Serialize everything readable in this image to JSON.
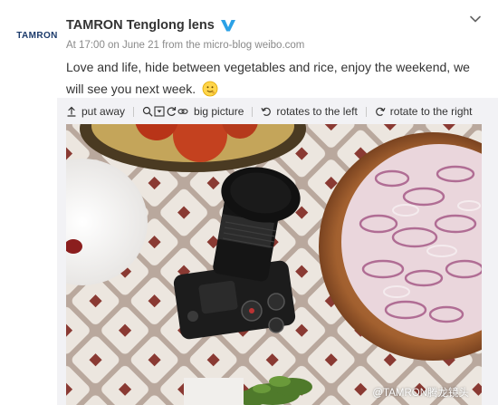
{
  "post": {
    "avatar_text": "TAMRON",
    "author": "TAMRON Tenglong lens",
    "verified_icon": "verified-v-icon",
    "meta": "At 17:00 on June 21 from the micro-blog weibo.com",
    "text": "Love and life, hide between vegetables and rice, enjoy the weekend, we will see you next week.",
    "emoji_icon": "smile-emoji-icon"
  },
  "toolbar": {
    "put_away": "put away",
    "big_picture": "big picture",
    "rotate_left": "rotates to the left",
    "rotate_right": "rotate to the right"
  },
  "photo": {
    "watermark": "@TAMRON腾龙镜头"
  },
  "colors": {
    "brand": "#1b3a6b",
    "verified": "#2ba1e6",
    "meta": "#8a8a8a",
    "toolbar_bg": "#f2f2f5"
  }
}
